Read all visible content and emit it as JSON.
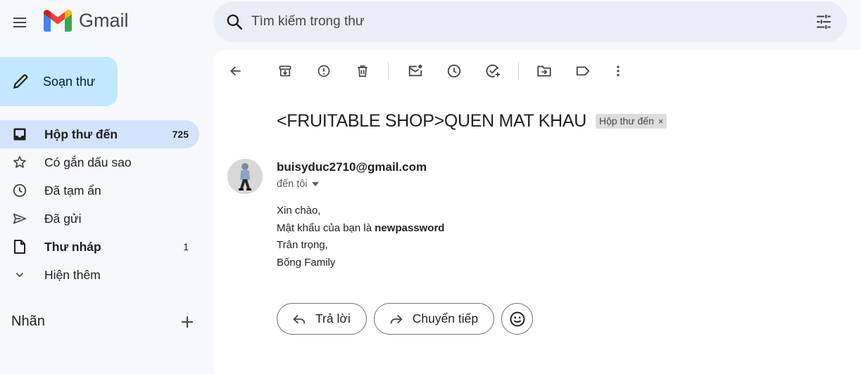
{
  "app": {
    "name": "Gmail"
  },
  "search": {
    "placeholder": "Tìm kiếm trong thư"
  },
  "compose": {
    "label": "Soạn thư"
  },
  "sidebar": {
    "items": [
      {
        "label": "Hộp thư đến",
        "count": "725"
      },
      {
        "label": "Có gắn dấu sao"
      },
      {
        "label": "Đã tạm ẩn"
      },
      {
        "label": "Đã gửi"
      },
      {
        "label": "Thư nháp",
        "count": "1"
      },
      {
        "label": "Hiện thêm"
      }
    ],
    "labels_title": "Nhãn"
  },
  "message": {
    "subject": "<FRUITABLE SHOP>QUEN MAT KHAU",
    "tag": "Hộp thư đến",
    "tag_close": "×",
    "sender": "buisyduc2710@gmail.com",
    "recipient": "đến tôi",
    "body": {
      "line1": "Xin chào,",
      "line2_prefix": "Mật khẩu của bạn là ",
      "line2_bold": "newpassword",
      "line3": "Trân trọng,",
      "line4": "Bống Family"
    }
  },
  "actions": {
    "reply": "Trả lời",
    "forward": "Chuyển tiếp"
  },
  "icons": {
    "menu": "menu-icon",
    "search": "search-icon",
    "filter": "tune-icon",
    "compose": "pencil-icon",
    "back": "arrow-back-icon",
    "archive": "archive-icon",
    "spam": "report-spam-icon",
    "delete": "trash-icon",
    "unread": "mark-unread-icon",
    "snooze": "snooze-clock-icon",
    "task": "add-task-icon",
    "move": "move-to-folder-icon",
    "label": "label-icon",
    "more": "more-vert-icon",
    "emoji": "emoji-icon"
  },
  "colors": {
    "background": "#f6f8fc",
    "compose_bg": "#c2e7ff",
    "active_nav_bg": "#d3e3fd",
    "search_bg": "#e9eef6",
    "gmail_red": "#ea4335",
    "gmail_blue": "#4285f4",
    "gmail_green": "#34a853",
    "gmail_yellow": "#fbbc04"
  }
}
